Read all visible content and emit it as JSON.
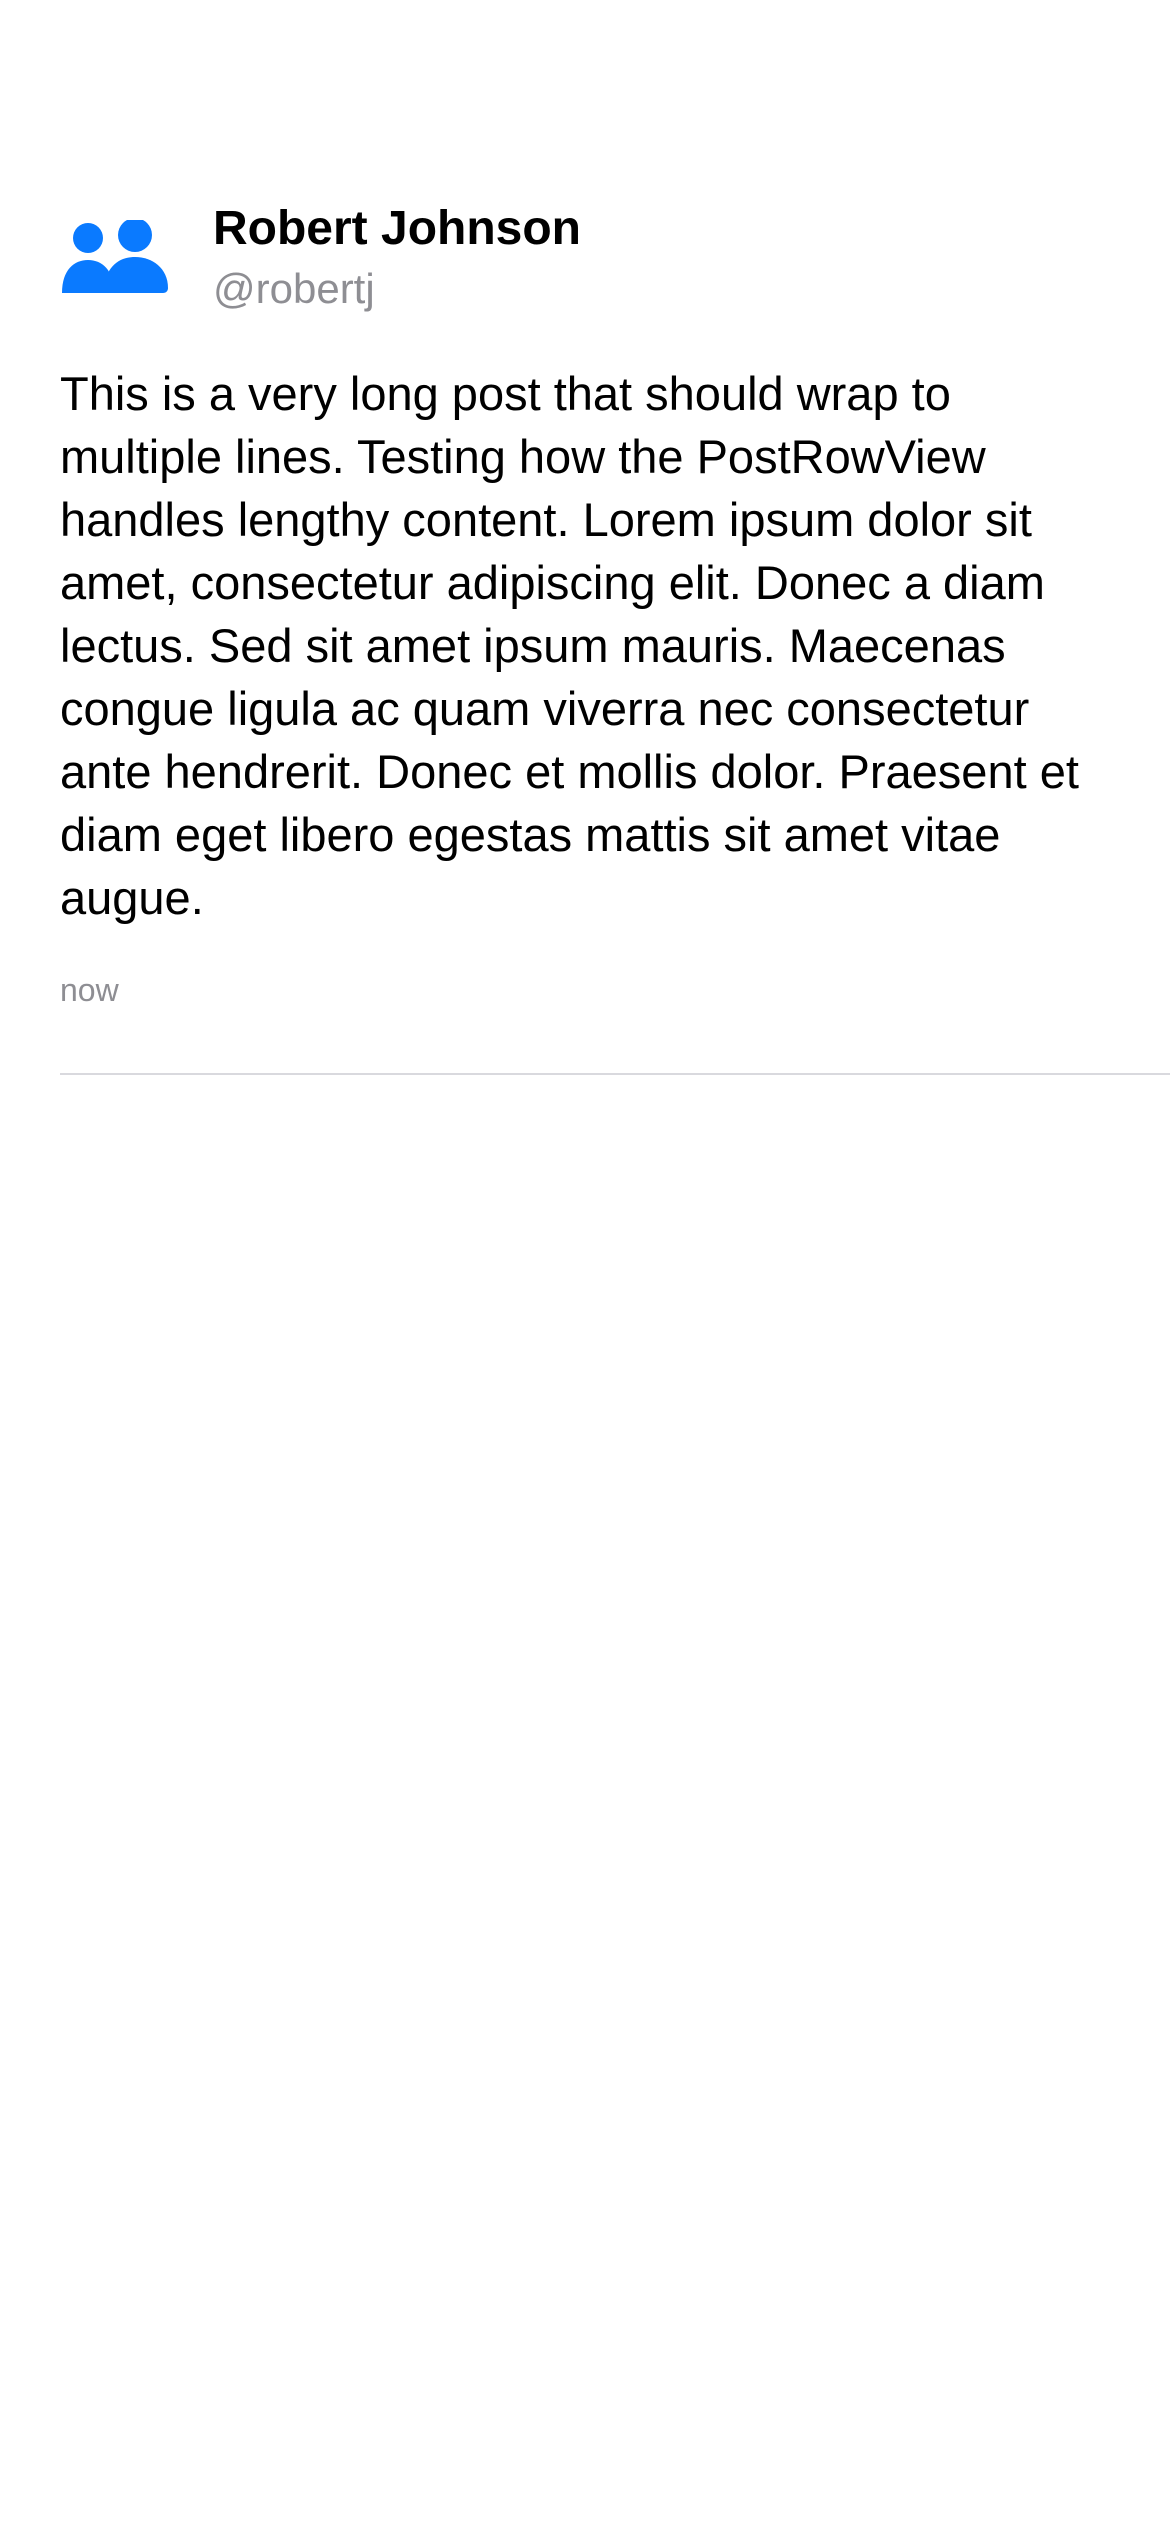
{
  "post": {
    "author": {
      "display_name": "Robert Johnson",
      "handle": "@robertj",
      "avatar_icon": "people-icon",
      "avatar_color": "#0a7aff"
    },
    "body": "This is a very long post that should wrap to multiple lines. Testing how the PostRowView handles lengthy content. Lorem ipsum dolor sit amet, consectetur adipiscing elit. Donec a diam lectus. Sed sit amet ipsum mauris. Maecenas congue ligula ac quam viverra nec consectetur ante hendrerit. Donec et mollis dolor. Praesent et diam eget libero egestas mattis sit amet vitae augue.",
    "timestamp": "now"
  }
}
